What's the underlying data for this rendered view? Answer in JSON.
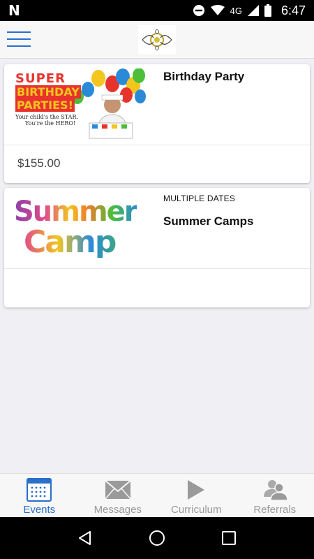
{
  "status_bar": {
    "time": "6:47",
    "network": "4G"
  },
  "events": [
    {
      "title": "Birthday Party",
      "subtitle": "",
      "price": "$155.00",
      "image": {
        "line1": "SUPER",
        "line2": "BIRTHDAY",
        "line3": "PARTIES!",
        "tag1": "Your child's the STAR.",
        "tag2": "You're the HERO!"
      }
    },
    {
      "title": "Summer Camps",
      "subtitle": "MULTIPLE DATES",
      "price": "",
      "image": {
        "word1": "Summer",
        "word2": "Camp"
      }
    }
  ],
  "tabs": [
    {
      "label": "Events",
      "icon": "calendar-icon",
      "active": true
    },
    {
      "label": "Messages",
      "icon": "envelope-icon",
      "active": false
    },
    {
      "label": "Curriculum",
      "icon": "play-icon",
      "active": false
    },
    {
      "label": "Referrals",
      "icon": "people-icon",
      "active": false
    }
  ],
  "colors": {
    "accent": "#2a6fc9",
    "inactive": "#999999",
    "background": "#efeff4"
  }
}
